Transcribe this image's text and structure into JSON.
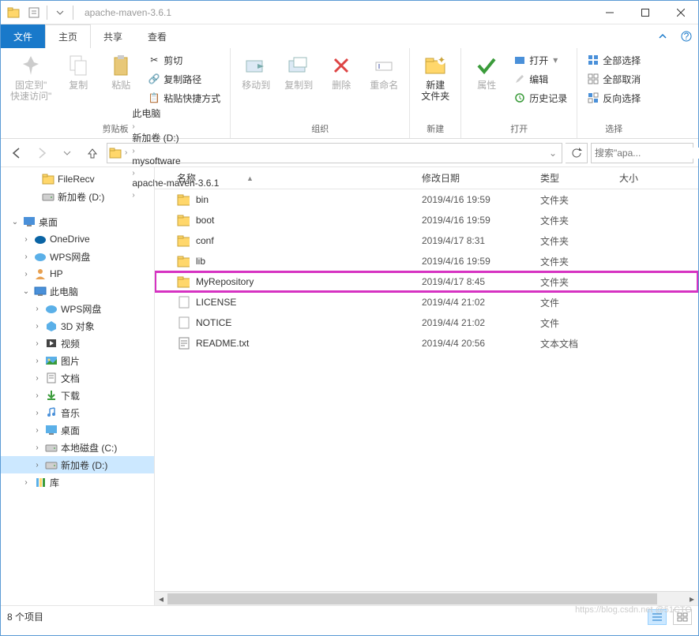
{
  "window": {
    "title": "apache-maven-3.6.1"
  },
  "ribbon": {
    "tabs": {
      "file": "文件",
      "home": "主页",
      "share": "共享",
      "view": "查看"
    },
    "groups": {
      "pin": {
        "label": "固定到\"\n快速访问\""
      },
      "copy": "复制",
      "paste": "粘贴",
      "cut": "剪切",
      "copypath": "复制路径",
      "pasteshortcut": "粘贴快捷方式",
      "clipboard": "剪贴板",
      "moveto": "移动到",
      "copyto": "复制到",
      "delete": "删除",
      "rename": "重命名",
      "organize": "组织",
      "newfolder": "新建\n文件夹",
      "new": "新建",
      "properties": "属性",
      "open": "打开",
      "edit": "编辑",
      "history": "历史记录",
      "opengroup": "打开",
      "selectall": "全部选择",
      "selectnone": "全部取消",
      "invert": "反向选择",
      "select": "选择"
    }
  },
  "breadcrumbs": [
    "此电脑",
    "新加卷 (D:)",
    "mysoftware",
    "apache-maven-3.6.1"
  ],
  "search": {
    "placeholder": "搜索\"apa..."
  },
  "tree": [
    {
      "label": "FileRecv",
      "icon": "folder",
      "indent": 28,
      "exp": ""
    },
    {
      "label": "新加卷 (D:)",
      "icon": "drive",
      "indent": 28,
      "exp": ""
    },
    {
      "spacer": true
    },
    {
      "label": "桌面",
      "icon": "desktop",
      "indent": 4,
      "exp": "v"
    },
    {
      "label": "OneDrive",
      "icon": "onedrive",
      "indent": 18,
      "exp": ">"
    },
    {
      "label": "WPS网盘",
      "icon": "wps",
      "indent": 18,
      "exp": ">"
    },
    {
      "label": "HP",
      "icon": "user",
      "indent": 18,
      "exp": ">"
    },
    {
      "label": "此电脑",
      "icon": "pc",
      "indent": 18,
      "exp": "v"
    },
    {
      "label": "WPS网盘",
      "icon": "wps",
      "indent": 32,
      "exp": ">"
    },
    {
      "label": "3D 对象",
      "icon": "3d",
      "indent": 32,
      "exp": ">"
    },
    {
      "label": "视频",
      "icon": "video",
      "indent": 32,
      "exp": ">"
    },
    {
      "label": "图片",
      "icon": "pictures",
      "indent": 32,
      "exp": ">"
    },
    {
      "label": "文档",
      "icon": "docs",
      "indent": 32,
      "exp": ">"
    },
    {
      "label": "下载",
      "icon": "downloads",
      "indent": 32,
      "exp": ">"
    },
    {
      "label": "音乐",
      "icon": "music",
      "indent": 32,
      "exp": ">"
    },
    {
      "label": "桌面",
      "icon": "desktop2",
      "indent": 32,
      "exp": ">"
    },
    {
      "label": "本地磁盘 (C:)",
      "icon": "drive",
      "indent": 32,
      "exp": ">"
    },
    {
      "label": "新加卷 (D:)",
      "icon": "drive",
      "indent": 32,
      "exp": ">",
      "selected": true
    },
    {
      "label": "库",
      "icon": "lib",
      "indent": 18,
      "exp": ">"
    }
  ],
  "columns": {
    "name": "名称",
    "date": "修改日期",
    "type": "类型",
    "size": "大小"
  },
  "files": [
    {
      "name": "bin",
      "date": "2019/4/16 19:59",
      "type": "文件夹",
      "icon": "folder"
    },
    {
      "name": "boot",
      "date": "2019/4/16 19:59",
      "type": "文件夹",
      "icon": "folder"
    },
    {
      "name": "conf",
      "date": "2019/4/17 8:31",
      "type": "文件夹",
      "icon": "folder"
    },
    {
      "name": "lib",
      "date": "2019/4/16 19:59",
      "type": "文件夹",
      "icon": "folder"
    },
    {
      "name": "MyRepository",
      "date": "2019/4/17 8:45",
      "type": "文件夹",
      "icon": "folder",
      "highlight": true
    },
    {
      "name": "LICENSE",
      "date": "2019/4/4 21:02",
      "type": "文件",
      "icon": "file"
    },
    {
      "name": "NOTICE",
      "date": "2019/4/4 21:02",
      "type": "文件",
      "icon": "file"
    },
    {
      "name": "README.txt",
      "date": "2019/4/4 20:56",
      "type": "文本文档",
      "icon": "txt"
    }
  ],
  "status": {
    "count": "8 个项目"
  },
  "watermark": "https://blog.csdn.net   @51CTO"
}
